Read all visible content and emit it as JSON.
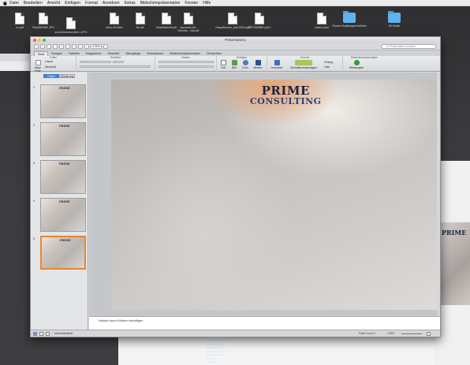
{
  "menubar": {
    "items": [
      "Datei",
      "Bearbeiten",
      "Ansicht",
      "Einfügen",
      "Format",
      "Anordnen",
      "Extras",
      "Bildschirmpräsentation",
      "Fenster",
      "Hilfe"
    ]
  },
  "desktop": {
    "icons": [
      {
        "label": "co.pdf",
        "kind": "doc"
      },
      {
        "label": "Pips50EMIE.JPG",
        "kind": "doc"
      },
      {
        "label": "sonderbeweschbie e.JPG",
        "kind": "doc"
      },
      {
        "label": "links.49 Alles",
        "kind": "doc"
      },
      {
        "label": "für die",
        "kind": "doc"
      },
      {
        "label": "Modellsbrett.pdf",
        "kind": "doc"
      },
      {
        "label": "Inprionte.der. Hinchst....bst.pdf",
        "kind": "doc"
      },
      {
        "label": "Hauptteinem_stat 2015.pdf",
        "kind": "doc"
      },
      {
        "label": "DRP2009BX.pdf 1",
        "kind": "doc"
      },
      {
        "label": "Listen.docx",
        "kind": "doc"
      },
      {
        "label": "iTunes Musikergebnisbhlen",
        "kind": "folder"
      },
      {
        "label": "Mi Musik",
        "kind": "folder"
      }
    ]
  },
  "window": {
    "title": "Präsentation1",
    "zoom": "176%",
    "search_placeholder": "In Präsentation suchen",
    "tabs": [
      "Start",
      "Designs",
      "Tabellen",
      "Diagramme",
      "SmartArt",
      "Übergänge",
      "Animationen",
      "Bildschirmpräsentation",
      "Überprüfen"
    ],
    "active_tab": "Start",
    "ribbon_groups": [
      "Folien",
      "Schriftart",
      "Absatz",
      "Einfügen",
      "Format",
      "Bildschirmpräsentation"
    ],
    "ribbon_buttons": {
      "new_slide": "Neue Folie",
      "layout": "Layout",
      "section": "Abschnitt",
      "text": "Text",
      "picture": "Bild",
      "shape": "Form",
      "media": "Medien",
      "arrange": "Anordnen",
      "quick_styles": "Schnellformatvorlagen",
      "fill": "Füllung",
      "line": "Linie",
      "play": "Wiedergabe"
    },
    "pane_tabs": [
      "Folien",
      "Gliederung"
    ],
    "slides": [
      {
        "num": "1",
        "selected": false
      },
      {
        "num": "2",
        "selected": false
      },
      {
        "num": "3",
        "selected": false
      },
      {
        "num": "4",
        "selected": false
      },
      {
        "num": "5",
        "selected": true
      }
    ],
    "brand_line1": "PRIME",
    "brand_line2": "CONSULTING",
    "notes_placeholder": "Notizen durch Klicken hinzufügen",
    "status_view": "Normalansicht",
    "status_slide": "Folie 5 von 5",
    "status_zoom": "176%"
  },
  "background": {
    "slide_title": "PRIME",
    "file_rows": [
      "2038-Grüne Urban",
      "2039-Frühlingbet",
      "2036 Feldhaber",
      "2036 Sommerhoff",
      "2037 Hoechbruch",
      "2038-GUIT",
      "2039-Damen"
    ]
  }
}
